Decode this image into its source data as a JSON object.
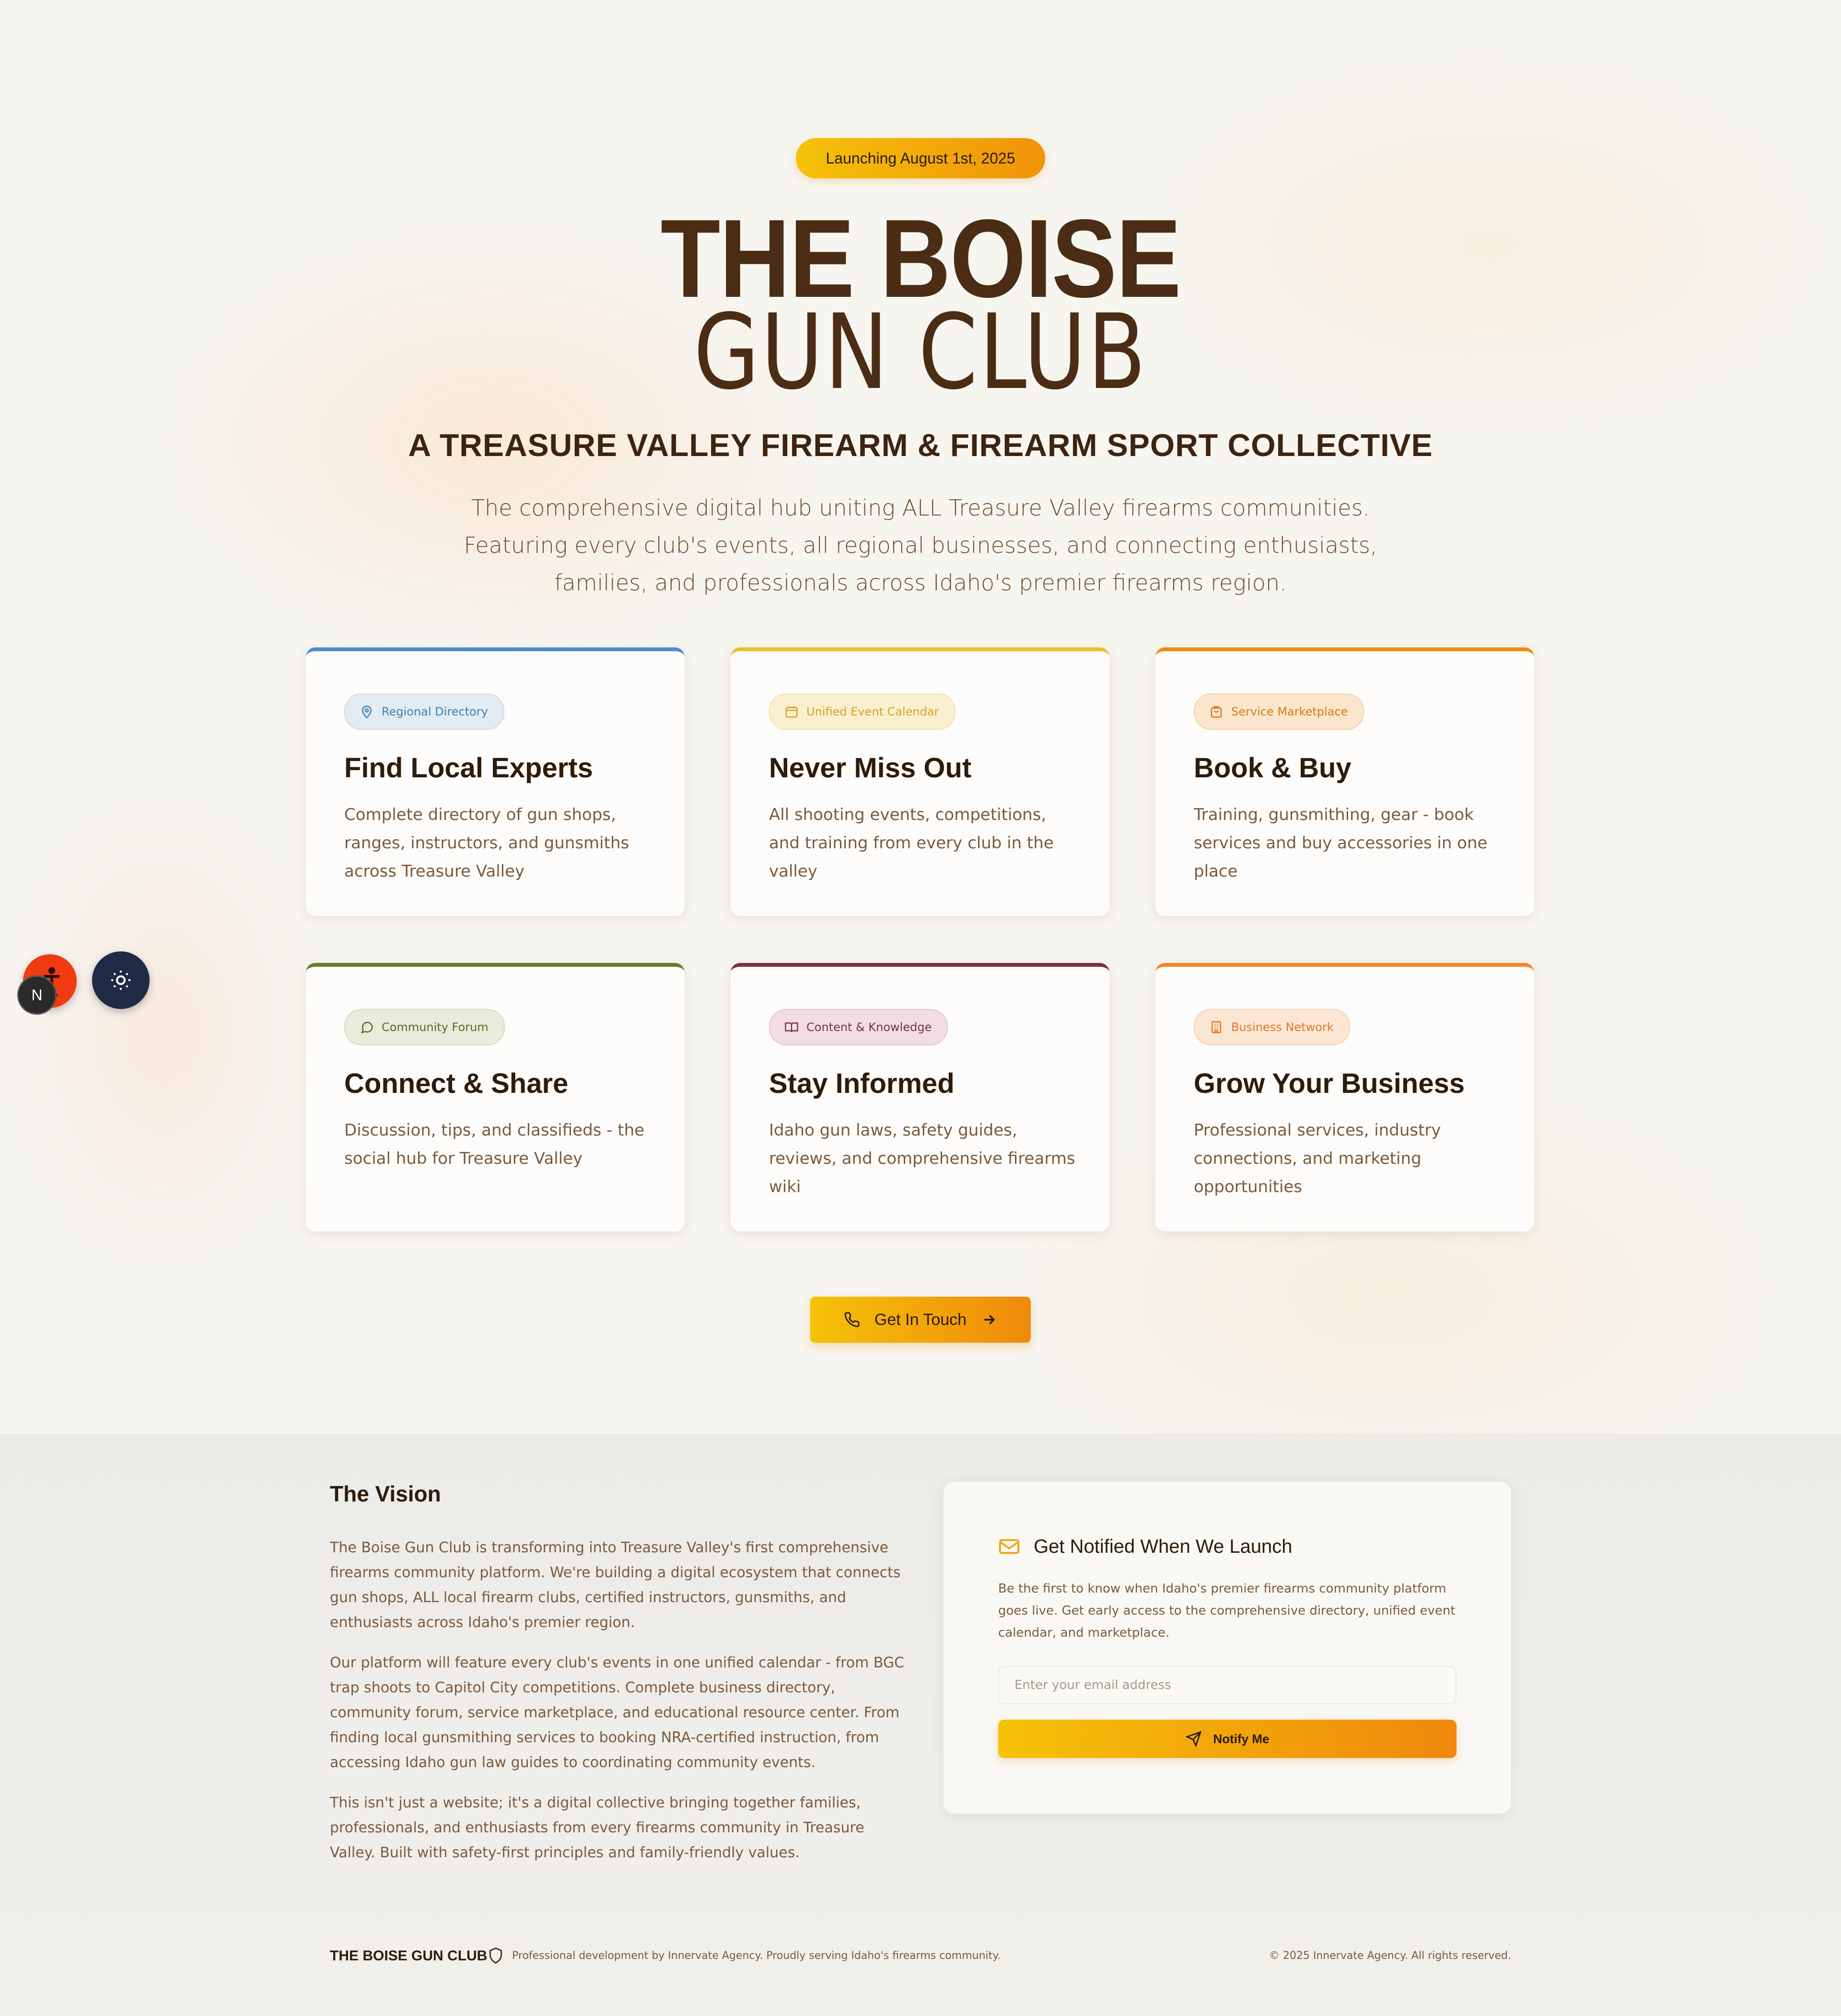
{
  "hero": {
    "badge": "Launching August 1st, 2025",
    "title_line1": "THE BOISE",
    "title_line2": "GUN CLUB",
    "tagline": "A TREASURE VALLEY FIREARM & FIREARM SPORT COLLECTIVE",
    "intro": "The comprehensive digital hub uniting ALL Treasure Valley firearms communities. Featuring every club's events, all regional businesses, and connecting enthusiasts, families, and professionals across Idaho's premier firearms region."
  },
  "features": [
    {
      "chip": "Regional Directory",
      "icon": "map-pin-icon",
      "title": "Find Local Experts",
      "desc": "Complete directory of gun shops, ranges, instructors, and gunsmiths across Treasure Valley",
      "accent": "#4a8fcf"
    },
    {
      "chip": "Unified Event Calendar",
      "icon": "calendar-icon",
      "title": "Never Miss Out",
      "desc": "All shooting events, competitions, and training from every club in the valley",
      "accent": "#e8bf2a"
    },
    {
      "chip": "Service Marketplace",
      "icon": "shopping-bag-icon",
      "title": "Book & Buy",
      "desc": "Training, gunsmithing, gear - book services and buy accessories in one place",
      "accent": "#f08c0e"
    },
    {
      "chip": "Community Forum",
      "icon": "chat-bubble-icon",
      "title": "Connect & Share",
      "desc": "Discussion, tips, and classifieds - the social hub for Treasure Valley",
      "accent": "#6b7a2a"
    },
    {
      "chip": "Content & Knowledge",
      "icon": "book-open-icon",
      "title": "Stay Informed",
      "desc": "Idaho gun laws, safety guides, reviews, and comprehensive firearms wiki",
      "accent": "#7a3048"
    },
    {
      "chip": "Business Network",
      "icon": "building-icon",
      "title": "Grow Your Business",
      "desc": "Professional services, industry connections, and marketing opportunities",
      "accent": "#f0872a"
    }
  ],
  "cta": {
    "label": "Get In Touch"
  },
  "floating": {
    "n_label": "N"
  },
  "vision": {
    "title": "The Vision",
    "p1": "The Boise Gun Club is transforming into Treasure Valley's first comprehensive firearms community platform. We're building a digital ecosystem that connects gun shops, ALL local firearm clubs, certified instructors, gunsmiths, and enthusiasts across Idaho's premier region.",
    "p2": "Our platform will feature every club's events in one unified calendar - from BGC trap shoots to Capitol City competitions. Complete business directory, community forum, service marketplace, and educational resource center. From finding local gunsmithing services to booking NRA-certified instruction, from accessing Idaho gun law guides to coordinating community events.",
    "p3": "This isn't just a website; it's a digital collective bringing together families, professionals, and enthusiasts from every firearms community in Treasure Valley. Built with safety-first principles and family-friendly values."
  },
  "notify": {
    "title": "Get Notified When We Launch",
    "desc": "Be the first to know when Idaho's premier firearms community platform goes live. Get early access to the comprehensive directory, unified event calendar, and marketplace.",
    "email_placeholder": "Enter your email address",
    "email_value": "",
    "button": "Notify Me"
  },
  "footer": {
    "brand": "THE BOISE GUN CLUB",
    "dev": "Professional development by Innervate Agency. Proudly serving Idaho's firearms community.",
    "copyright": "© 2025 Innervate Agency. All rights reserved."
  },
  "colors": {
    "background": "#f7f5f0",
    "brand_brown": "#4a2d14",
    "accent_gradient_start": "#f5c208",
    "accent_gradient_end": "#f0880c"
  }
}
